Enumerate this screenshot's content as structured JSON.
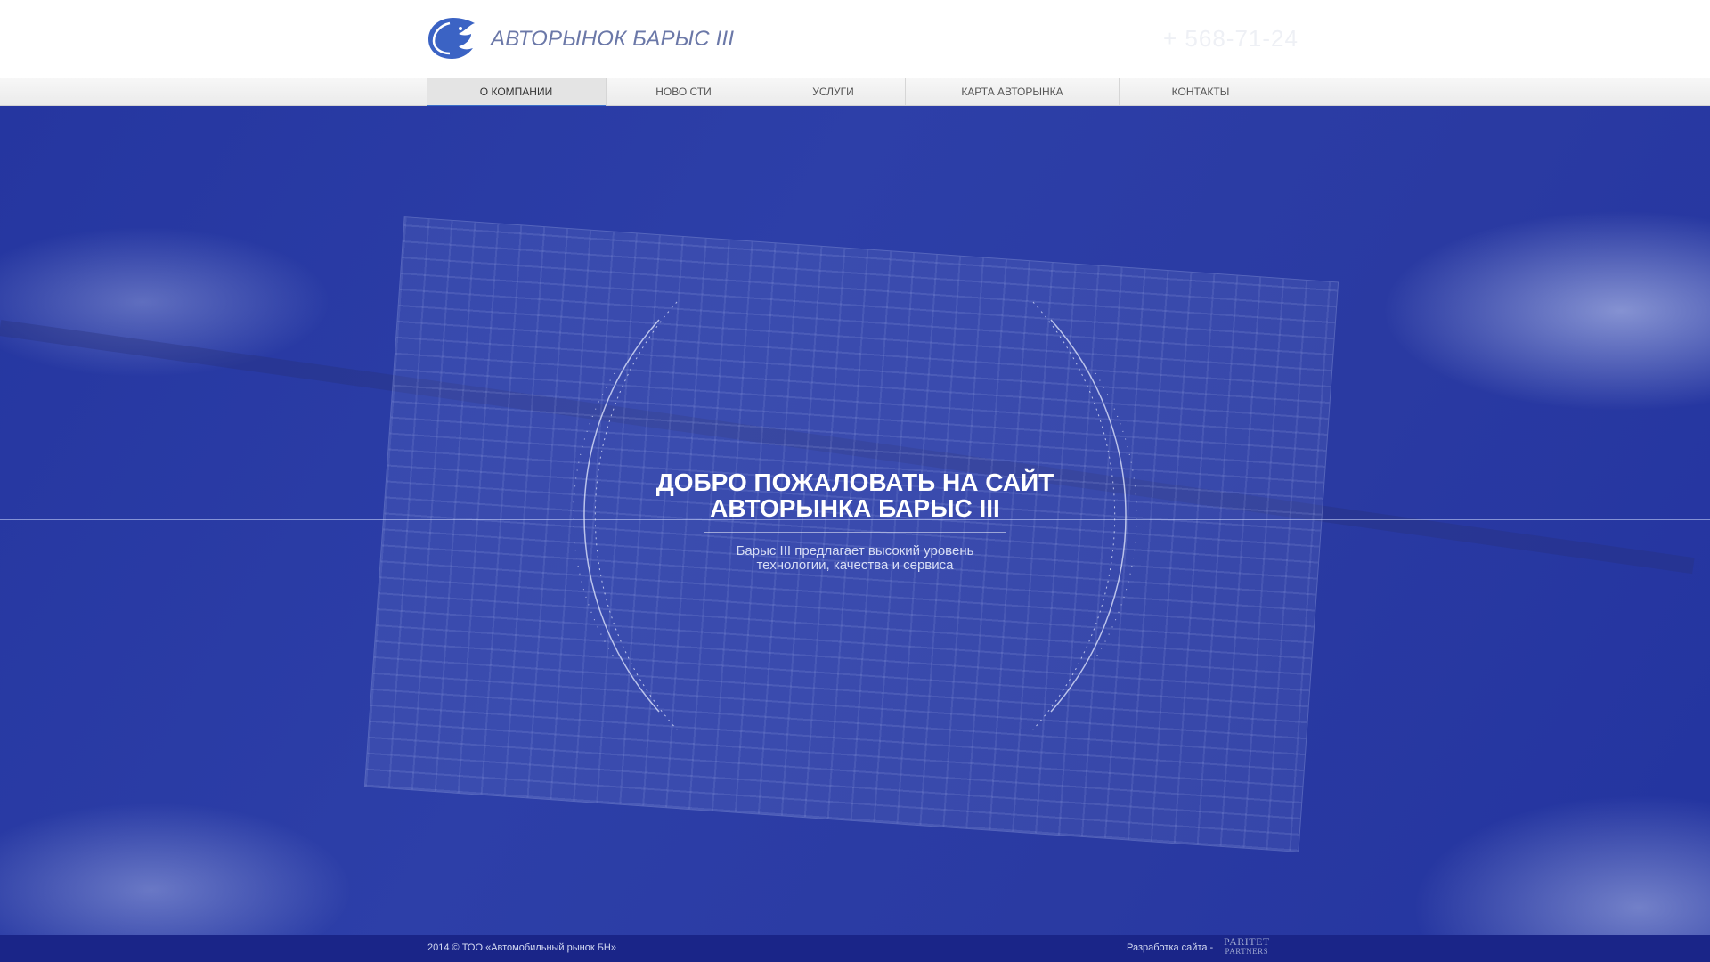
{
  "header": {
    "site_title": "АВТОРЫНОК БАРЫС III",
    "phone": "+ 568-71-24"
  },
  "nav": {
    "items": [
      {
        "label": "О КОМПАНИИ",
        "active": true
      },
      {
        "label": "НОВО СТИ",
        "active": false
      },
      {
        "label": "УСЛУГИ",
        "active": false
      },
      {
        "label": "КАРТА АВТОРЫНКА",
        "active": false
      },
      {
        "label": "КОНТАКТЫ",
        "active": false
      }
    ]
  },
  "hero": {
    "headline_line1": "ДОБРО ПОЖАЛОВАТЬ НА САЙТ",
    "headline_line2": "АВТОРЫНКА БАРЫС III",
    "subtitle_line1": "Барыс III предлагает высокий уровень",
    "subtitle_line2": "технологии, качества и сервиса"
  },
  "footer": {
    "copyright": "2014 © ТОО «Автомобильный рынок БН»",
    "dev_label": "Разработка сайта -",
    "dev_logo_top": "PARITET",
    "dev_logo_bottom": "PARTNERS"
  },
  "colors": {
    "accent": "#3b6fc8",
    "hero_overlay": "#2b3aa0",
    "footer": "#1a2588"
  },
  "icons": {
    "logo": "snow-leopard-logo-icon"
  }
}
